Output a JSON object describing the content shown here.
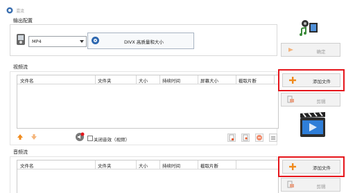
{
  "window": {
    "title": "混流"
  },
  "output": {
    "section_label": "输出配置",
    "format_value": "MP4",
    "quality_label": "DIVX 高质量和大小",
    "confirm_label": "确定"
  },
  "video": {
    "section_label": "视频流",
    "columns": [
      "文件名",
      "文件夹",
      "大小",
      "持续时间",
      "屏幕大小",
      "截取片断"
    ],
    "add_label": "添加文件",
    "edit_label": "剪辑",
    "close_audio_label": "关闭音效（视频）"
  },
  "audio": {
    "section_label": "音频流",
    "columns": [
      "文件名",
      "文件夹",
      "大小",
      "持续时间",
      "截取片断"
    ],
    "add_label": "添加文件",
    "edit_label": "剪辑"
  },
  "colors": {
    "highlight": "#e5151b",
    "add_icon": "#f08a1c"
  }
}
